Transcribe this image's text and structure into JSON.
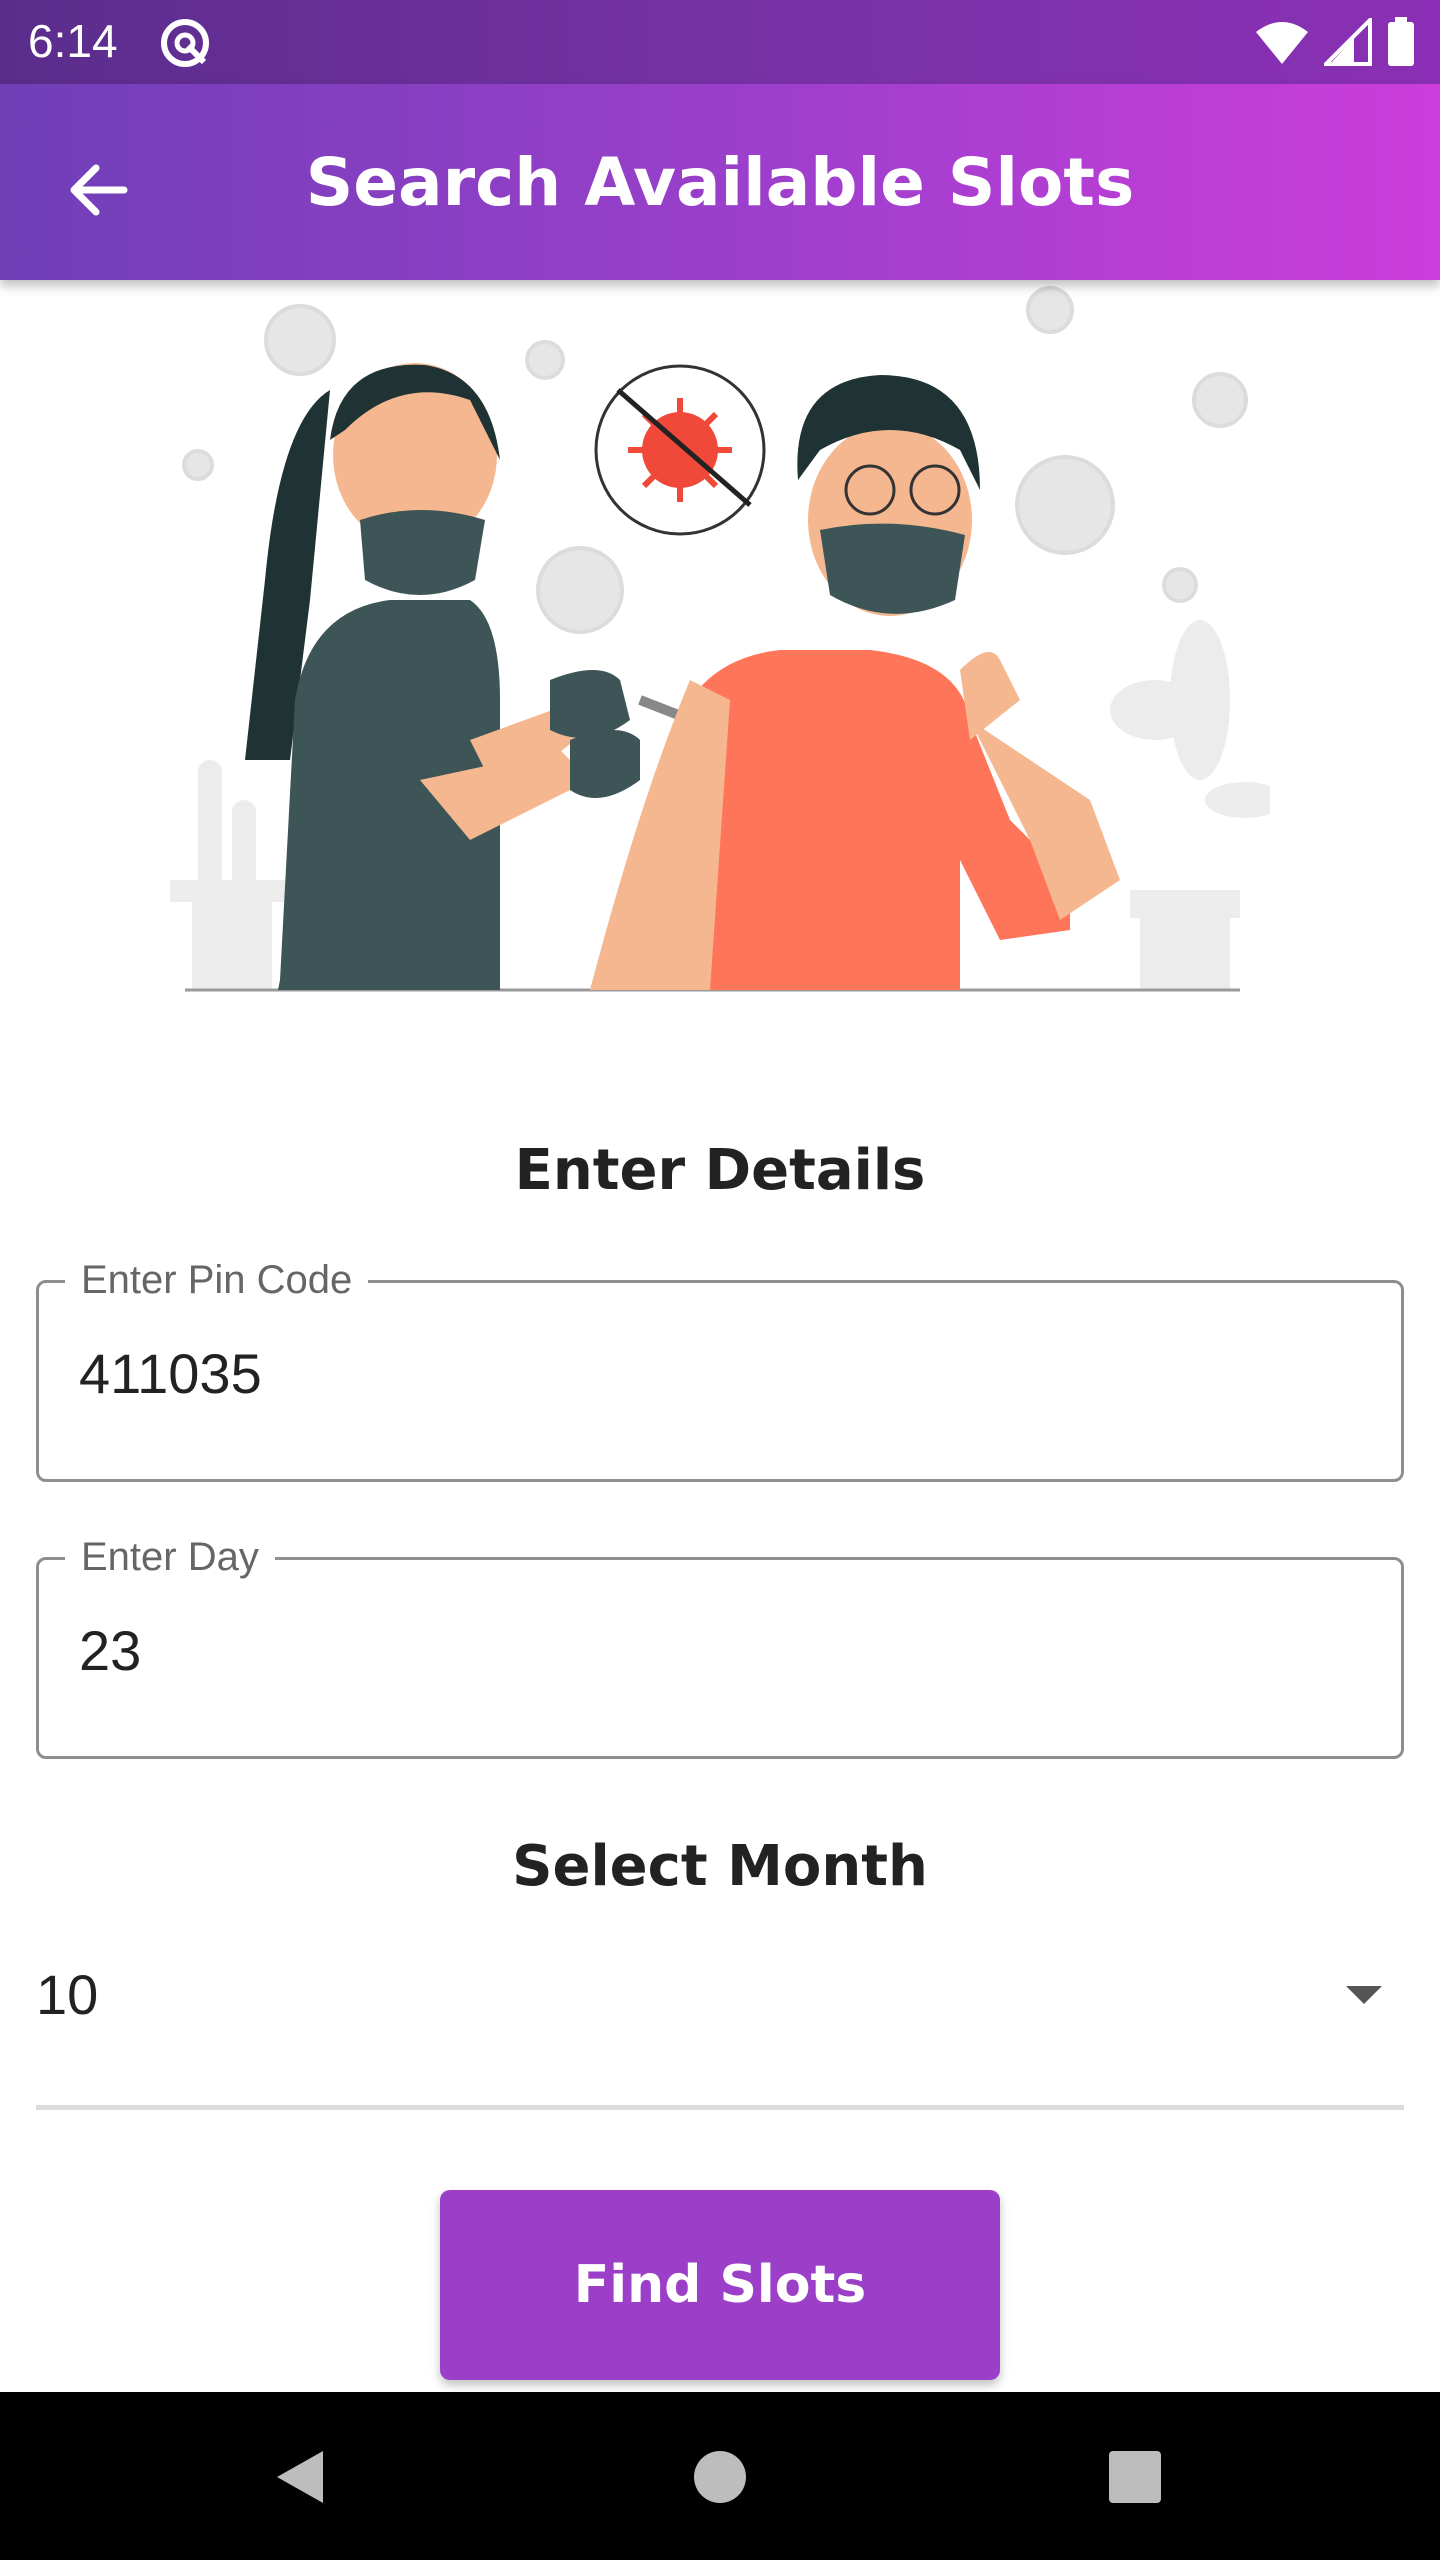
{
  "status_bar": {
    "time": "6:14",
    "icons": [
      "app-notification-icon",
      "wifi-icon",
      "cell-signal-icon",
      "battery-icon"
    ]
  },
  "app_bar": {
    "title": "Search Available Slots",
    "back_icon": "arrow-left-icon"
  },
  "illustration": {
    "subject": "vaccination-illustration",
    "colors": {
      "shirt": "#ff7559",
      "scrubs": "#3e5558",
      "virus": "#f0493a"
    }
  },
  "form": {
    "heading": "Enter Details",
    "pin_code": {
      "label": "Enter Pin Code",
      "value": "411035"
    },
    "day": {
      "label": "Enter Day",
      "value": "23"
    },
    "month_heading": "Select Month",
    "month": {
      "selected": "10"
    },
    "submit_label": "Find Slots"
  },
  "nav_bar": {
    "buttons": [
      "back-triangle-icon",
      "home-circle-icon",
      "recents-square-icon"
    ]
  },
  "colors": {
    "app_bar_start": "#6f3fb6",
    "app_bar_end": "#cc3ddc",
    "button": "#9b3fc8"
  }
}
